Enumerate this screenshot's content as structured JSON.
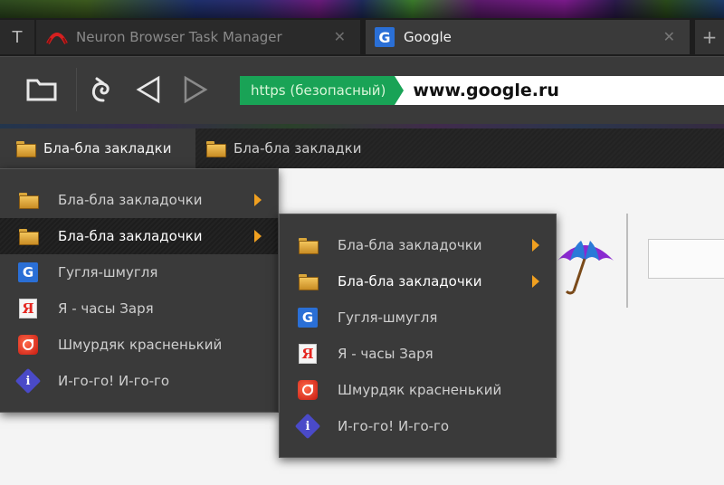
{
  "tabs": [
    {
      "label": "Neuron Browser Task Manager",
      "close": "✕"
    },
    {
      "label": "Google",
      "close": "✕",
      "favicon": "G"
    }
  ],
  "tab_first_icon": "T",
  "tab_add": "+",
  "toolbar": {
    "https_label": "https (безопасный)",
    "url": "www.google.ru"
  },
  "bookmarks_bar": [
    {
      "label": "Бла-бла закладки",
      "active": true
    },
    {
      "label": "Бла-бла закладки",
      "active": false
    }
  ],
  "menu_1": [
    {
      "label": "Бла-бла закладочки",
      "icon": "folder-icon",
      "submenu": true
    },
    {
      "label": "Бла-бла закладочки",
      "icon": "folder-icon",
      "submenu": true,
      "highlighted": true
    },
    {
      "label": "Гугля-шмугля",
      "icon": "google-icon"
    },
    {
      "label": "Я - часы Заря",
      "icon": "yandex-icon"
    },
    {
      "label": "Шмурдяк красненький",
      "icon": "red-app-icon"
    },
    {
      "label": "И-го-го! И-го-го",
      "icon": "info-icon"
    }
  ],
  "menu_2": [
    {
      "label": "Бла-бла закладочки",
      "icon": "folder-icon",
      "submenu": true
    },
    {
      "label": "Бла-бла закладочки",
      "icon": "folder-icon",
      "submenu": true
    },
    {
      "label": "Гугля-шмугля",
      "icon": "google-icon"
    },
    {
      "label": "Я - часы Заря",
      "icon": "yandex-icon"
    },
    {
      "label": "Шмурдяк красненький",
      "icon": "red-app-icon"
    },
    {
      "label": "И-го-го! И-го-го",
      "icon": "info-icon"
    }
  ],
  "icon_glyphs": {
    "google": "G",
    "yandex": "Я",
    "info": "i"
  },
  "colors": {
    "https_green": "#19a356",
    "arrow_orange": "#f0a020",
    "google_blue": "#2a6fd6"
  }
}
